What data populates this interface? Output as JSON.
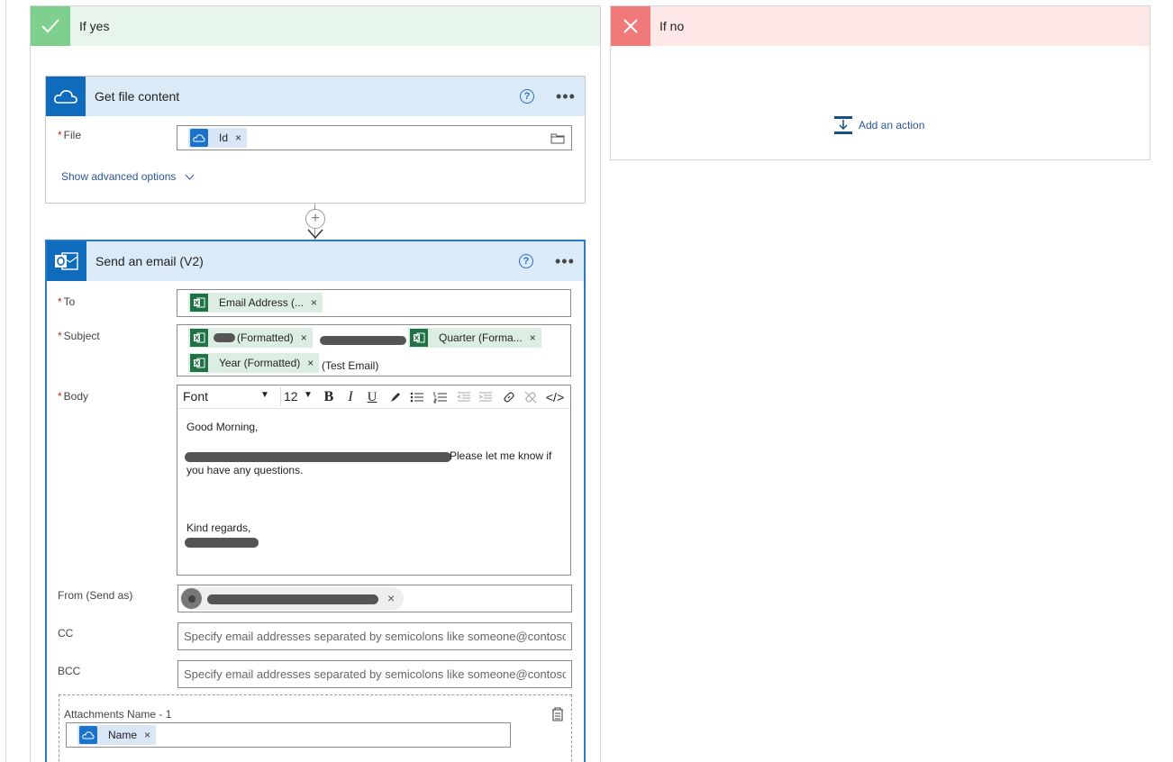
{
  "branches": {
    "yes": {
      "title": "If yes",
      "color": "#7fcf8e",
      "bg": "#e8f5ea"
    },
    "no": {
      "title": "If no",
      "color": "#f07a7a",
      "bg": "#fde7e7",
      "add_action": "Add an action"
    }
  },
  "get_file_content": {
    "title": "Get file content",
    "file_label": "File",
    "file_token": "Id",
    "advanced": "Show advanced options"
  },
  "send_email": {
    "title": "Send an email (V2)",
    "to_label": "To",
    "to_token": "Email Address (...",
    "subject_label": "Subject",
    "subject_tokens": {
      "t1": "(Formatted)",
      "t2": "Quarter (Forma...",
      "t3": "Year (Formatted)"
    },
    "subject_suffix": "(Test Email)",
    "body_label": "Body",
    "font_select": "Font",
    "size_select": "12",
    "toolbar": {
      "bold": "B",
      "italic": "I",
      "underline": "U",
      "code": "</>"
    },
    "body_lines": {
      "greeting": "Good Morning,",
      "line2_tail": "Please let me know if",
      "line3": "you have any questions.",
      "closing": "Kind regards,"
    },
    "from_label": "From (Send as)",
    "cc_label": "CC",
    "cc_placeholder": "Specify email addresses separated by semicolons like someone@contoso.com",
    "bcc_label": "BCC",
    "bcc_placeholder": "Specify email addresses separated by semicolons like someone@contoso.com",
    "attachments_label": "Attachments Name - 1",
    "attachment_token": "Name"
  },
  "icons": {
    "check": "check-icon",
    "close": "close-icon",
    "onedrive": "onedrive-icon",
    "outlook": "outlook-icon",
    "help": "help-icon",
    "more": "more-icon",
    "excel": "excel-icon"
  }
}
